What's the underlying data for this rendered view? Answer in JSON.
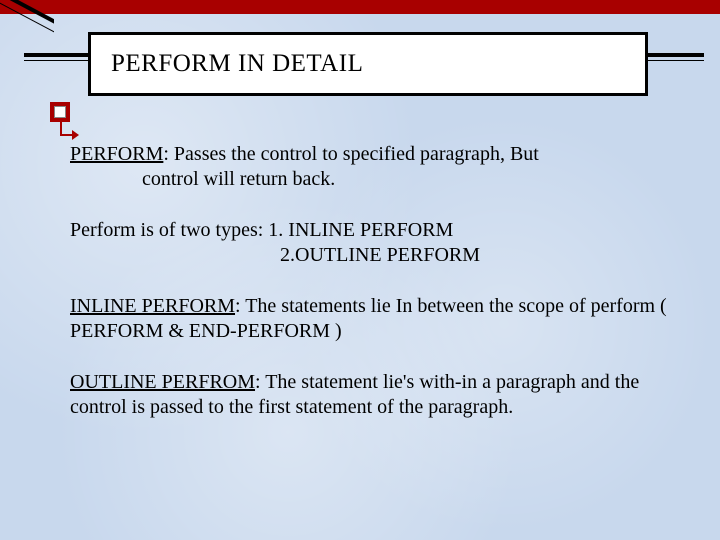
{
  "title": "PERFORM IN DETAIL",
  "perform": {
    "term": "PERFORM",
    "desc_line1": ": Passes the control to specified paragraph, But",
    "desc_line2": "control will return back."
  },
  "types": {
    "intro": "Perform is of two types: 1. INLINE PERFORM",
    "line2": "2.OUTLINE PERFORM"
  },
  "inline": {
    "term": "INLINE PERFORM",
    "desc": ": The statements lie In between the scope of perform ( PERFORM & END-PERFORM )"
  },
  "outline": {
    "term": "OUTLINE PERFROM",
    "desc": ": The statement lie's  with-in a paragraph and the control is passed to the first statement of the paragraph."
  }
}
